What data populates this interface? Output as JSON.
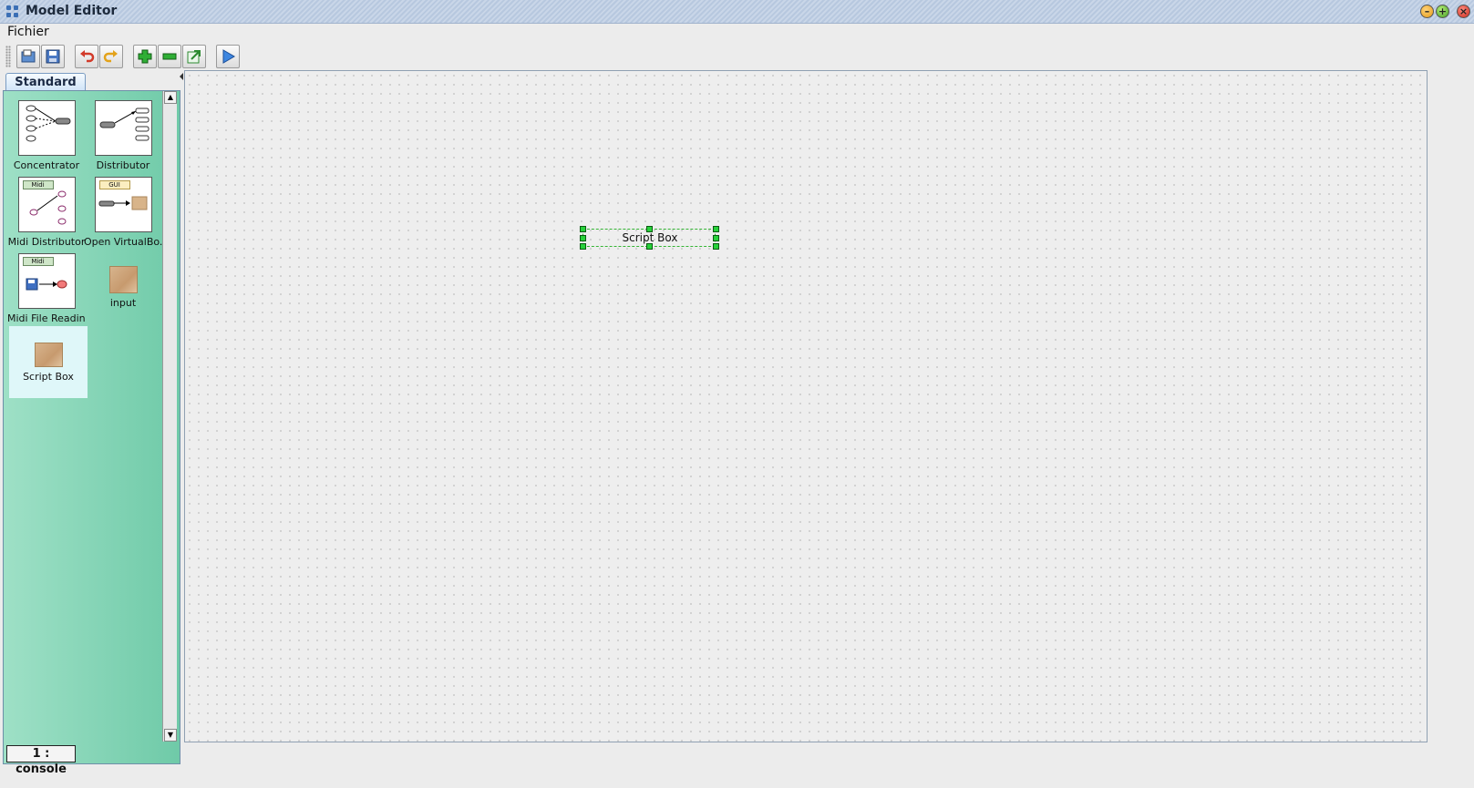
{
  "window": {
    "title": "Model Editor"
  },
  "menu": {
    "items": [
      "Fichier"
    ]
  },
  "toolbar": {
    "buttons": [
      "open-icon",
      "save-icon",
      "undo-icon",
      "redo-icon",
      "add-icon",
      "remove-icon",
      "export-icon",
      "play-icon"
    ]
  },
  "palette": {
    "tab_label": "Standard",
    "items": [
      {
        "label": "Concentrator",
        "icon": "concentrator-icon"
      },
      {
        "label": "Distributor",
        "icon": "distributor-icon"
      },
      {
        "label": "Midi Distributor",
        "icon": "midi-distributor-icon",
        "badge": "Midi"
      },
      {
        "label": "Open VirtualBo...",
        "icon": "open-virtual-box-icon",
        "badge": "GUI"
      },
      {
        "label": "Midi File Reading",
        "icon": "midi-file-reading-icon",
        "badge": "Midi"
      },
      {
        "label": "input",
        "icon": "input-icon"
      },
      {
        "label": "Script Box",
        "icon": "script-box-icon",
        "selected": true
      }
    ]
  },
  "canvas": {
    "nodes": [
      {
        "label": "Script Box",
        "selected": true
      }
    ]
  },
  "bottom": {
    "console_tab": "1 : console"
  },
  "colors": {
    "palette_bg": "#7ed3b2",
    "selection_handle": "#27d13a",
    "tab_bg": "#cfe3f7"
  }
}
